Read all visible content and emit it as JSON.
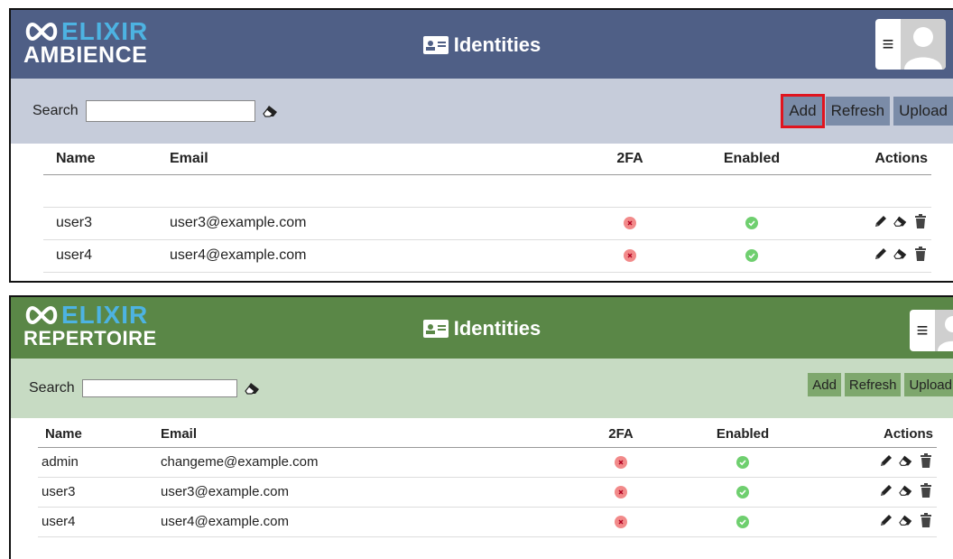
{
  "panels": [
    {
      "logo": {
        "top": "ELIXIR",
        "sub": "AMBIENCE"
      },
      "title": "Identities",
      "search_label": "Search",
      "search_value": "",
      "buttons": {
        "add": "Add",
        "refresh": "Refresh",
        "upload": "Upload"
      },
      "columns": {
        "name": "Name",
        "email": "Email",
        "twofa": "2FA",
        "enabled": "Enabled",
        "actions": "Actions"
      },
      "rows": [
        {
          "name": "user3",
          "email": "user3@example.com",
          "twofa": false,
          "enabled": true
        },
        {
          "name": "user4",
          "email": "user4@example.com",
          "twofa": false,
          "enabled": true
        }
      ],
      "highlighted_button": "add",
      "colors": {
        "header": "#4f5f86",
        "searchbar": "#c6ccda",
        "button": "#7b8ca8"
      }
    },
    {
      "logo": {
        "top": "ELIXIR",
        "sub": "REPERTOIRE"
      },
      "title": "Identities",
      "search_label": "Search",
      "search_value": "",
      "buttons": {
        "add": "Add",
        "refresh": "Refresh",
        "upload": "Upload"
      },
      "columns": {
        "name": "Name",
        "email": "Email",
        "twofa": "2FA",
        "enabled": "Enabled",
        "actions": "Actions"
      },
      "rows": [
        {
          "name": "admin",
          "email": "changeme@example.com",
          "twofa": false,
          "enabled": true
        },
        {
          "name": "user3",
          "email": "user3@example.com",
          "twofa": false,
          "enabled": true
        },
        {
          "name": "user4",
          "email": "user4@example.com",
          "twofa": false,
          "enabled": true
        }
      ],
      "colors": {
        "header": "#5a8747",
        "searchbar": "#c7dbc3",
        "button": "#7ea76d"
      }
    }
  ],
  "icons": {
    "logo": "infinity-icon",
    "title": "id-card-icon",
    "menu": "hamburger-icon",
    "avatar": "avatar-icon",
    "clear_search": "eraser-icon",
    "status_no": "x-circle-icon",
    "status_yes": "check-circle-icon",
    "edit": "pencil-icon",
    "reset": "eraser-icon",
    "delete": "trash-icon"
  }
}
